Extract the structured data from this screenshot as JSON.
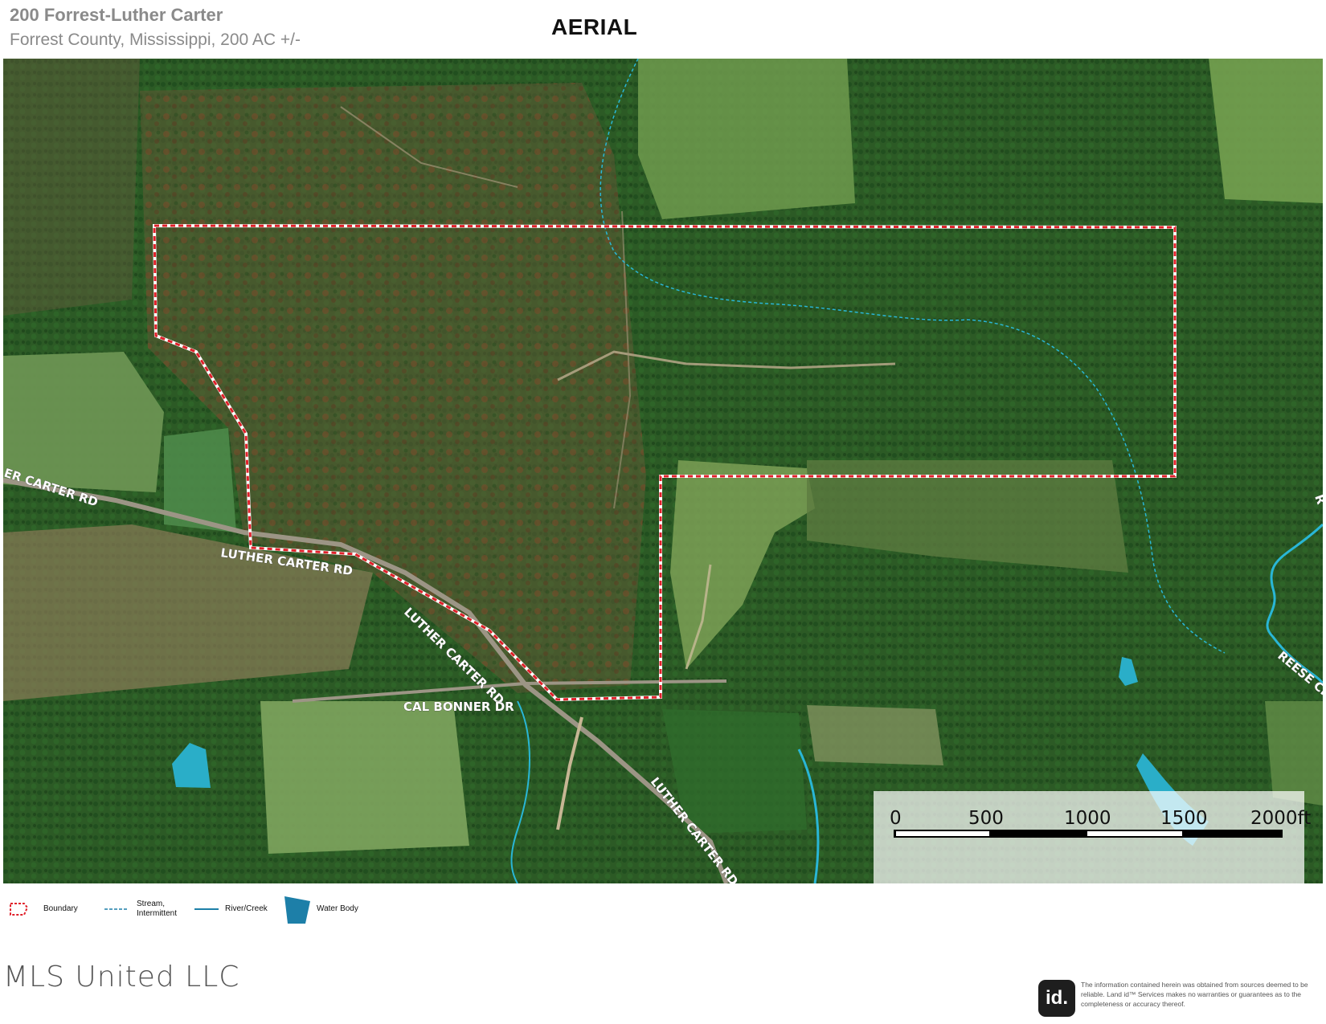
{
  "header": {
    "title": "200 Forrest-Luther Carter",
    "subtitle": "Forrest County, Mississippi, 200 AC +/-",
    "view_label": "AERIAL"
  },
  "map": {
    "roads": [
      {
        "label": "ER CARTER RD"
      },
      {
        "label": "LUTHER CARTER RD"
      },
      {
        "label": "LUTHER CARTER RD"
      },
      {
        "label": "CAL BONNER DR"
      },
      {
        "label": "LUTHER CARTER RD"
      },
      {
        "label": "REESE CRE"
      },
      {
        "label": "R"
      }
    ],
    "scale_bar": {
      "ticks": [
        "0",
        "500",
        "1000",
        "1500",
        "2000ft"
      ]
    },
    "colors": {
      "boundary": "#e0202a",
      "stream": "#29b6d6",
      "water_body": "#2aaec8"
    }
  },
  "legend": {
    "items": [
      {
        "label": "Boundary",
        "icon": "boundary-icon"
      },
      {
        "label": "Stream, Intermittent",
        "icon": "stream-intermittent-icon"
      },
      {
        "label": "River/Creek",
        "icon": "river-creek-icon"
      },
      {
        "label": "Water Body",
        "icon": "water-body-icon"
      }
    ]
  },
  "footer": {
    "brand": "MLS United LLC",
    "logo_text": "id.",
    "disclaimer": "The information contained herein was obtained from sources deemed to be reliable. Land id™ Services makes no warranties or guarantees as to the completeness or accuracy thereof."
  }
}
